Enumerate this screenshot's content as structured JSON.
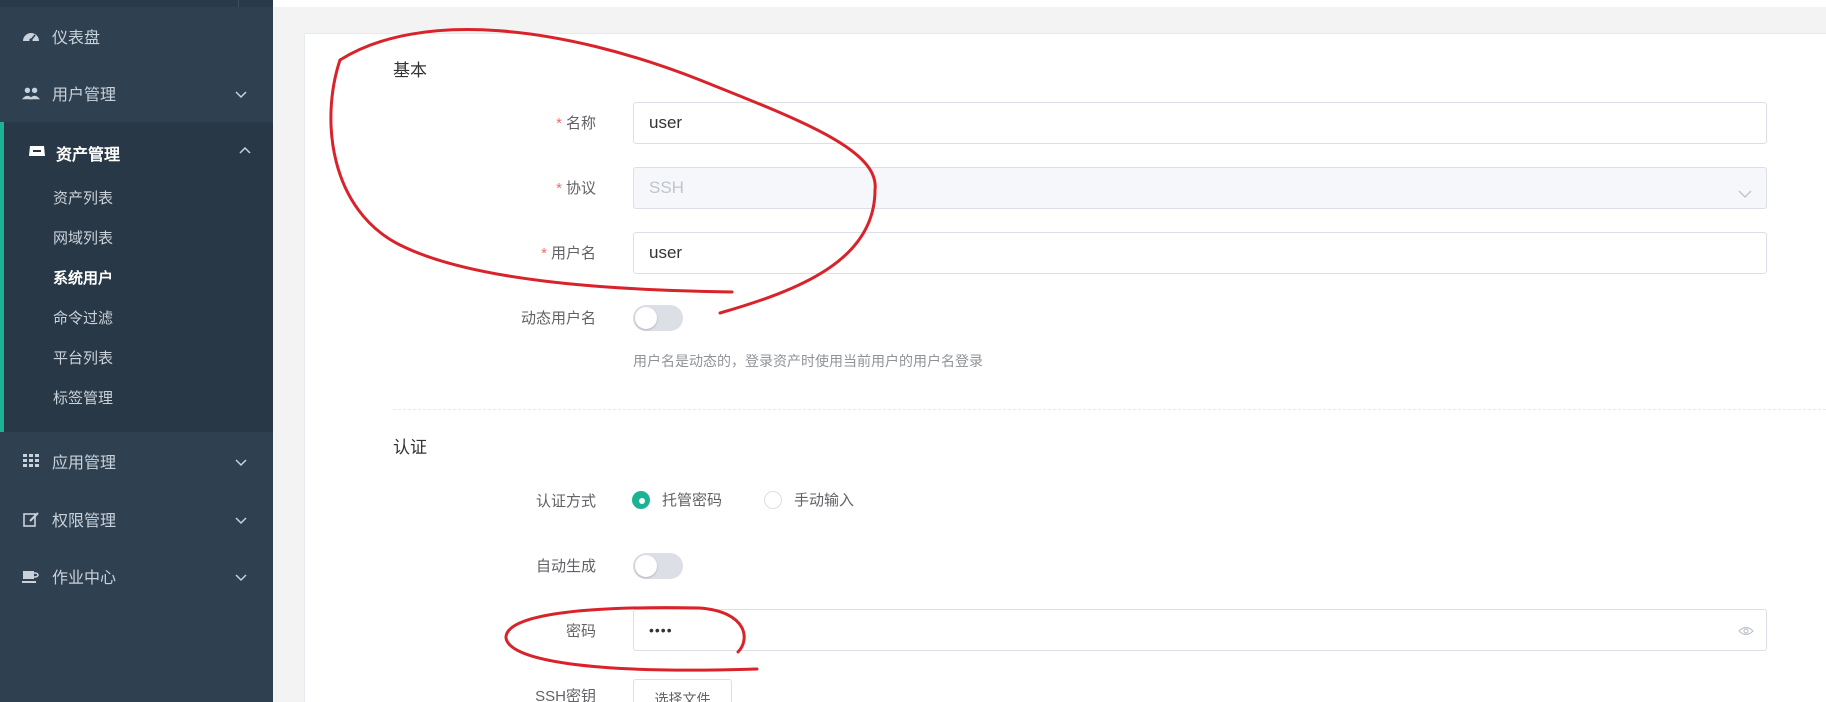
{
  "sidebar": {
    "items": [
      {
        "label": "仪表盘",
        "icon": "dashboard-icon"
      },
      {
        "label": "用户管理",
        "icon": "users-icon"
      },
      {
        "label": "资产管理",
        "icon": "inbox-icon"
      },
      {
        "label": "应用管理",
        "icon": "grid-icon"
      },
      {
        "label": "权限管理",
        "icon": "edit-icon"
      },
      {
        "label": "作业中心",
        "icon": "coffee-icon"
      }
    ],
    "asset_submenu": [
      "资产列表",
      "网域列表",
      "系统用户",
      "命令过滤",
      "平台列表",
      "标签管理"
    ],
    "active_submenu": "系统用户",
    "accent_color": "#1ab394"
  },
  "form": {
    "basic": {
      "title": "基本",
      "name_label": "名称",
      "name_value": "user",
      "protocol_label": "协议",
      "protocol_value": "SSH",
      "username_label": "用户名",
      "username_value": "user",
      "dynamic_label": "动态用户名",
      "dynamic_help": "用户名是动态的，登录资产时使用当前用户的用户名登录",
      "required_mark": "*"
    },
    "auth": {
      "title": "认证",
      "method_label": "认证方式",
      "method_options": [
        "托管密码",
        "手动输入"
      ],
      "method_selected": "托管密码",
      "autogen_label": "自动生成",
      "password_label": "密码",
      "password_value": "••••",
      "sshkey_label": "SSH密钥",
      "file_button": "选择文件"
    }
  }
}
